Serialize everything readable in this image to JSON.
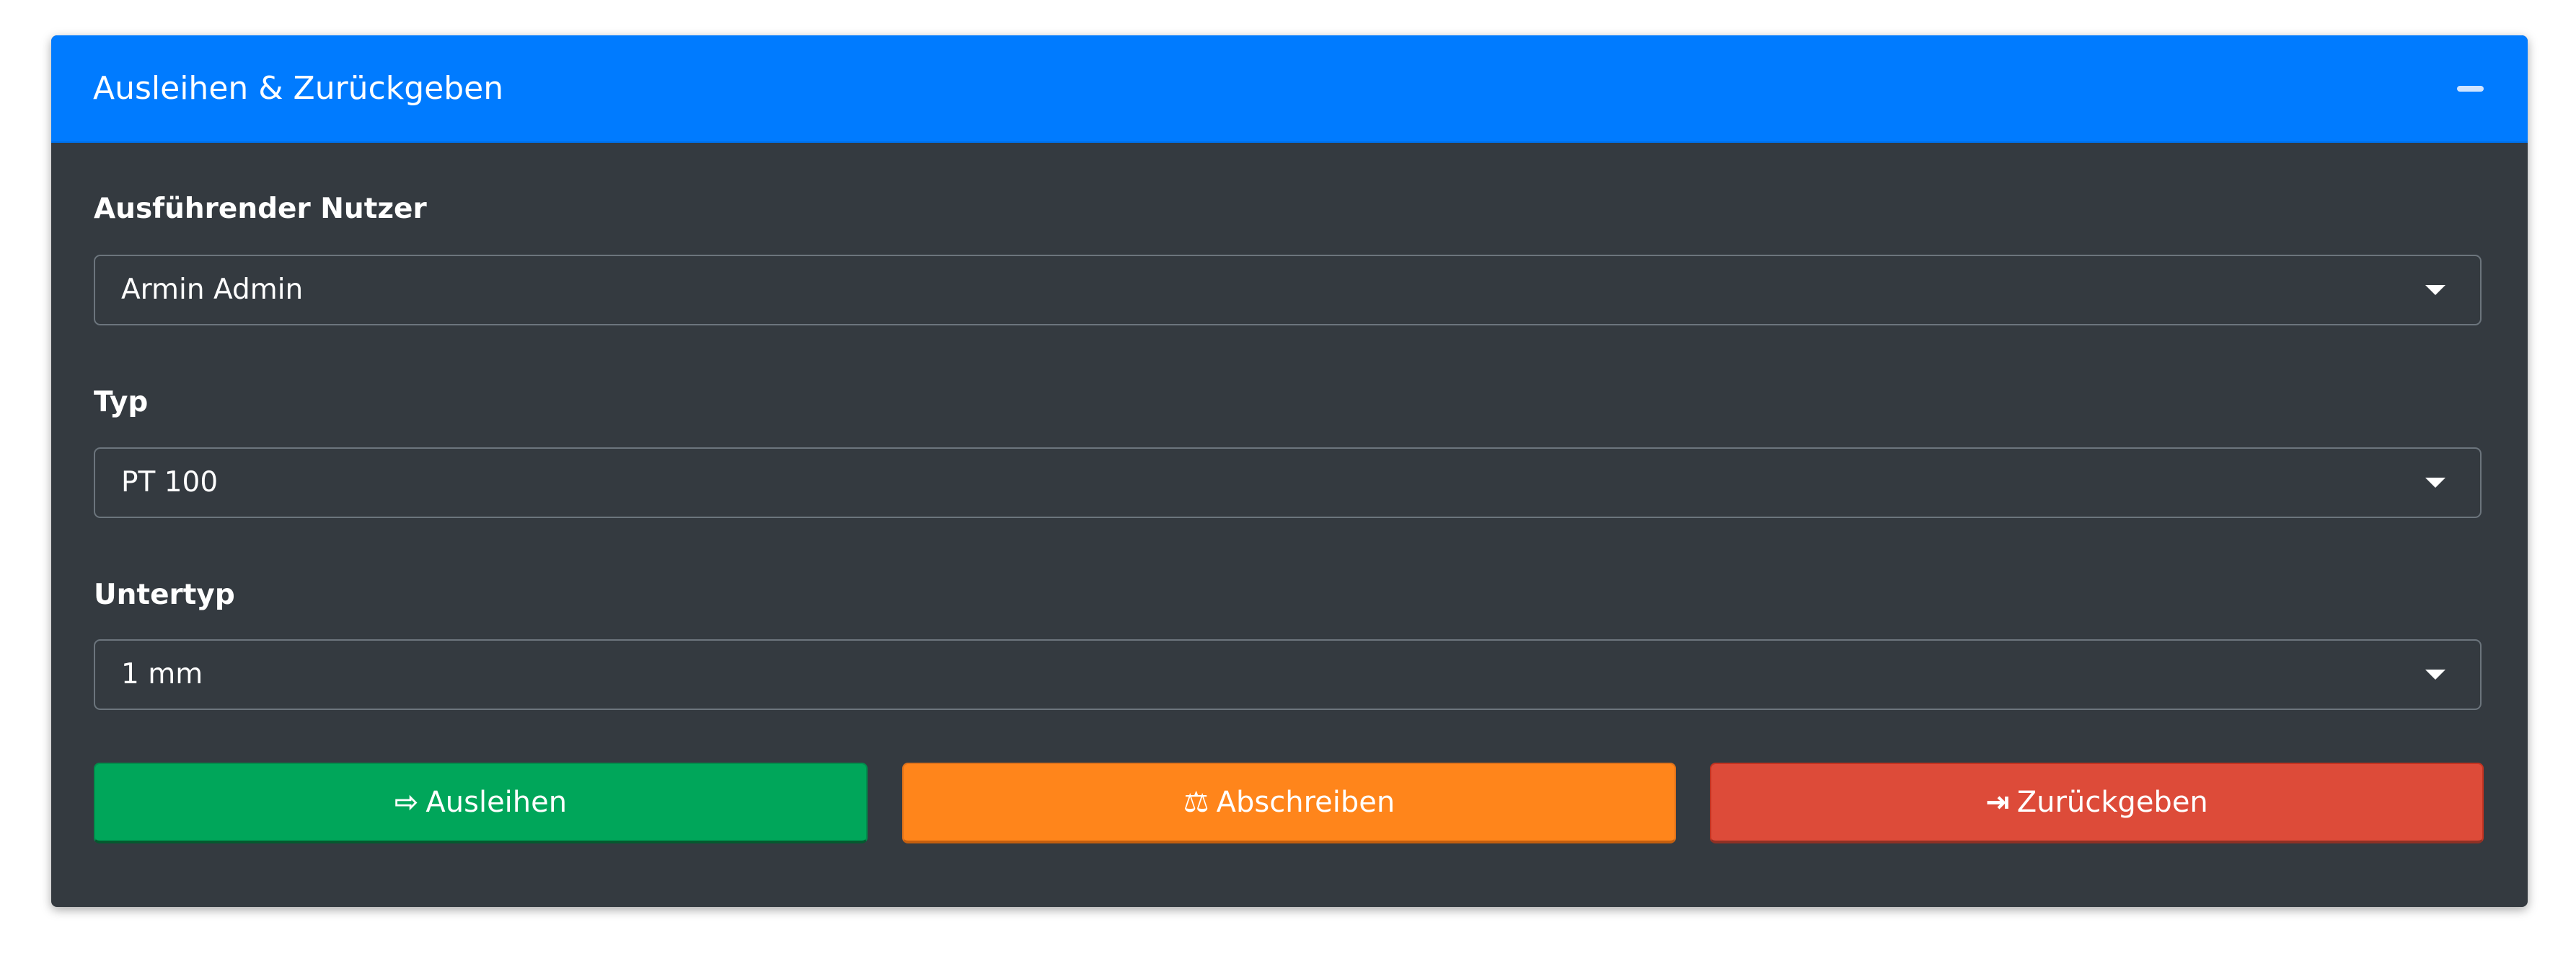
{
  "card": {
    "title": "Ausleihen & Zurückgeben",
    "collapse_icon": "minus-icon"
  },
  "form": {
    "user": {
      "label": "Ausführender Nutzer",
      "value": "Armin Admin"
    },
    "type": {
      "label": "Typ",
      "value": "PT 100"
    },
    "subtype": {
      "label": "Untertyp",
      "value": "1 mm"
    }
  },
  "buttons": {
    "lend": {
      "label": "Ausleihen",
      "icon": "sign-out-icon",
      "color": "#00a65a"
    },
    "write_off": {
      "label": "Abschreiben",
      "icon": "balance-scale-icon",
      "color": "#ff851b"
    },
    "return": {
      "label": "Zurückgeben",
      "icon": "sign-in-icon",
      "color": "#dd4b39"
    }
  }
}
